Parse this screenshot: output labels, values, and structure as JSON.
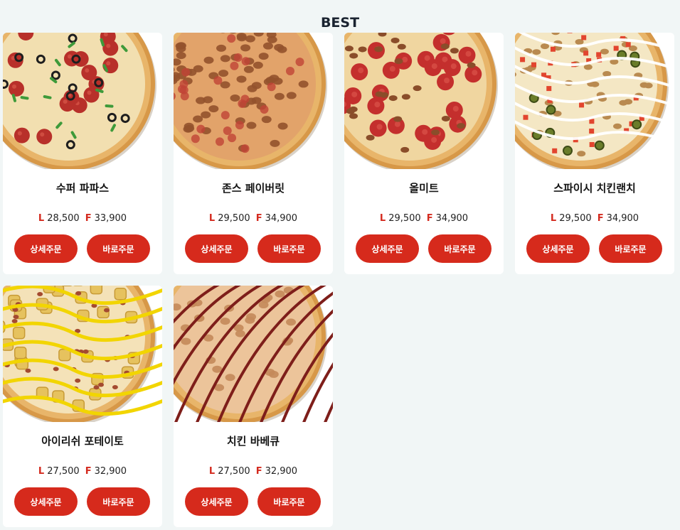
{
  "section": {
    "title": "BEST"
  },
  "labels": {
    "large": "L",
    "family": "F"
  },
  "colors": {
    "accent": "#d62a1c",
    "background": "#f1f6f6",
    "card": "#ffffff"
  },
  "products": [
    {
      "name": "수퍼 파파스",
      "price_l": "28,500",
      "price_f": "33,900",
      "detail_label": "상세주문",
      "quick_label": "바로주문",
      "topping": "supreme"
    },
    {
      "name": "존스 페이버릿",
      "price_l": "29,500",
      "price_f": "34,900",
      "detail_label": "상세주문",
      "quick_label": "바로주문",
      "topping": "sausage"
    },
    {
      "name": "올미트",
      "price_l": "29,500",
      "price_f": "34,900",
      "detail_label": "상세주문",
      "quick_label": "바로주문",
      "topping": "allmeat"
    },
    {
      "name": "스파이시 치킨랜치",
      "price_l": "29,500",
      "price_f": "34,900",
      "detail_label": "상세주문",
      "quick_label": "바로주문",
      "topping": "chicken-ranch"
    },
    {
      "name": "아이리쉬 포테이토",
      "price_l": "27,500",
      "price_f": "32,900",
      "detail_label": "상세주문",
      "quick_label": "바로주문",
      "topping": "potato"
    },
    {
      "name": "치킨 바베큐",
      "price_l": "27,500",
      "price_f": "32,900",
      "detail_label": "상세주문",
      "quick_label": "바로주문",
      "topping": "bbq"
    }
  ]
}
